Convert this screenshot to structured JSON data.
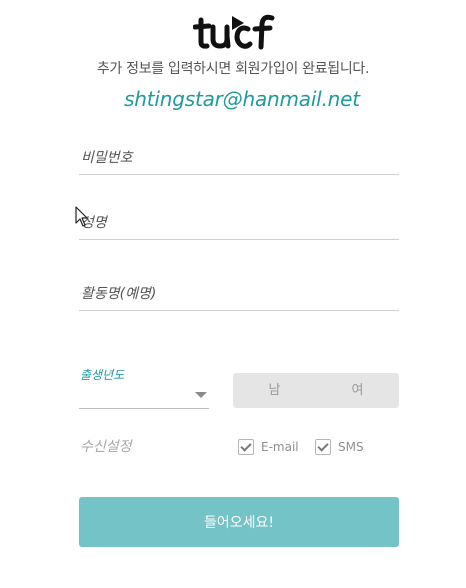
{
  "header": {
    "logo_text": "tucf",
    "subtitle": "추가 정보를 입력하시면 회원가입이 완료됩니다.",
    "email": "shtingstar@hanmail.net"
  },
  "form": {
    "password": {
      "placeholder": "비밀번호",
      "value": ""
    },
    "name": {
      "placeholder": "성명",
      "value": ""
    },
    "nickname": {
      "placeholder": "활동명(예명)",
      "value": ""
    },
    "birth_year": {
      "label": "출생년도",
      "value": ""
    },
    "gender": {
      "male": "남",
      "female": "여"
    },
    "receive": {
      "label": "수신설정",
      "email_label": "E-mail",
      "email_checked": true,
      "sms_label": "SMS",
      "sms_checked": true
    },
    "submit_label": "들어오세요!"
  },
  "colors": {
    "accent": "#1f9a9f",
    "button": "#74c3c7",
    "toggle_bg": "#e5e5e5"
  },
  "icons": [
    "tucf-logo",
    "chevron-down-icon",
    "checkbox-icon",
    "mouse-cursor-icon"
  ]
}
